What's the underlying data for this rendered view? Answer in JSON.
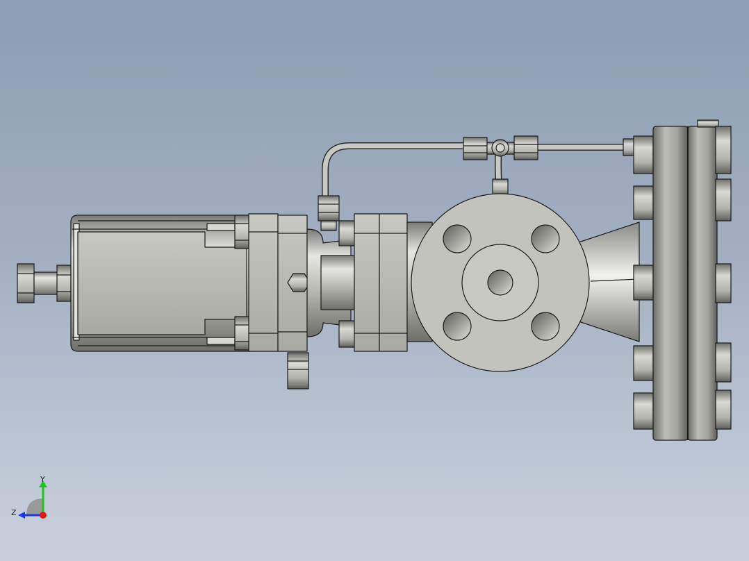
{
  "viewport": {
    "background_top": "#8d9db2",
    "background_bottom": "#c9d0dc"
  },
  "model": {
    "part_color": "#bdbdb8",
    "edge_color": "#1c1c1c"
  },
  "triad": {
    "y_label": "Y",
    "z_label": "Z",
    "y_color": "#1ec31e",
    "z_color": "#1c38e0",
    "x_color": "#e01818"
  }
}
